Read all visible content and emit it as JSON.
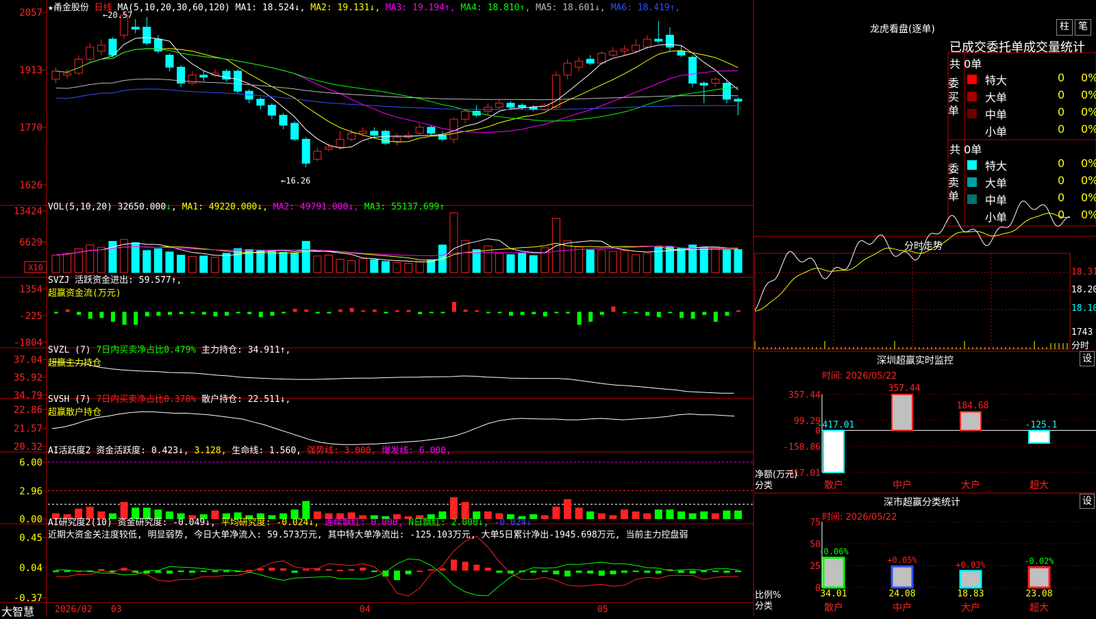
{
  "colors": {
    "up": "#ff2222",
    "down": "#00ffff",
    "grid": "#c00000",
    "text": "#ffffff",
    "yellow": "#ffff00",
    "magenta": "#ff00ff",
    "green": "#00ff00",
    "cyan": "#00ffff",
    "white": "#ffffff",
    "blue": "#3050ff",
    "gray": "#bbbbbb",
    "red": "#ff2222"
  },
  "stock": {
    "name": "★甬金股份",
    "period": "日线",
    "ma_label": "MA(5,10,20,30,60,120)",
    "ma": [
      {
        "name": "MA1:",
        "value": "18.524",
        "arrow": "↓",
        "color": "white"
      },
      {
        "name": "MA2:",
        "value": "19.131",
        "arrow": "↓",
        "color": "yellow"
      },
      {
        "name": "MA3:",
        "value": "19.194",
        "arrow": "↑",
        "color": "magenta"
      },
      {
        "name": "MA4:",
        "value": "18.810",
        "arrow": "↑",
        "color": "green"
      },
      {
        "name": "MA5:",
        "value": "18.601",
        "arrow": "↓",
        "color": "gray"
      },
      {
        "name": "MA6:",
        "value": "18.419",
        "arrow": "↑",
        "color": "blue"
      }
    ],
    "high_label": "←20.57",
    "low_label": "←16.26",
    "price_ticks": [
      "2057",
      "1913",
      "1770",
      "1626"
    ]
  },
  "volume": {
    "label": "VOL(5,10,20)",
    "value": "32650.000",
    "arrow": "↓",
    "ma": [
      {
        "t": "MA1: 49220.000↓,",
        "c": "yellow"
      },
      {
        "t": "MA2: 49791.000↓,",
        "c": "magenta"
      },
      {
        "t": "MA3: 55137.699↑",
        "c": "green"
      }
    ],
    "ticks": [
      "13424",
      "6629"
    ],
    "unit": "X10"
  },
  "svzj": {
    "label": "SVZJ  活跃资金进出: 59.577↑,",
    "sub": "超赢资金流(万元)",
    "ticks": [
      "1354",
      "-225",
      "-1804"
    ]
  },
  "svzl": {
    "label1": "SVZL (7)",
    "label2": "7日内买卖净占比0.479%",
    "label3": "主力持仓: 34.911↑,",
    "sub": "超赢主力持仓",
    "ticks": [
      "37.04",
      "35.92",
      "34.79"
    ]
  },
  "svsh": {
    "label1": "SVSH (7)",
    "label2": "7日内买卖净占比0.378%",
    "label3": "散户持仓: 22.511↓,",
    "sub": "超赢散户持仓",
    "ticks": [
      "22.86",
      "21.57",
      "20.32"
    ]
  },
  "ai1": {
    "label1": "AI活跃度2 资金活跃度: 0.423↓,",
    "label2": "3.128,",
    "label3": "生命线: 1.560,",
    "label4": "强势线: 3.000,",
    "label5": "爆发线: 6.000,",
    "ticks": [
      "6.00",
      "2.96",
      "0.00"
    ]
  },
  "ai2": {
    "label1": "AI研究度2(10) 资金研究度: -0.049↓,",
    "label2": "平均研究度: -0.024↓,",
    "label3": "连续飘红: 0.000,",
    "label4": "N日飘红: 2.000↓,",
    "label5": "-0.024↓",
    "text": "近期大资金关注度较低, 明显弱势, 今日大单净流入: 59.573万元, 其中特大单净流出: -125.103万元, 大单5日累计净出-1945.698万元, 当前主力控盘弱",
    "ticks": [
      "0.45",
      "0.04",
      "-0.37"
    ]
  },
  "bottom": {
    "brand": "大智慧",
    "year": "2026/02",
    "m1": "03",
    "m2": "04",
    "m3": "05"
  },
  "dragon": {
    "title": "龙虎看盘(逐单)",
    "btn1": "柱",
    "btn2": "笔",
    "subtitle": "已成交委托单成交量统计",
    "buy": {
      "total": "共 0单",
      "side": "委买单",
      "rows": [
        {
          "name": "特大",
          "v": "0",
          "p": "0%",
          "c": "#ff0000"
        },
        {
          "name": "大单",
          "v": "0",
          "p": "0%",
          "c": "#a00000"
        },
        {
          "name": "中单",
          "v": "0",
          "p": "0%",
          "c": "#700000"
        },
        {
          "name": "小单",
          "v": "0",
          "p": "0%",
          "c": "#000000"
        }
      ]
    },
    "sell": {
      "total": "共 0单",
      "side": "委卖单",
      "rows": [
        {
          "name": "特大",
          "v": "0",
          "p": "0%",
          "c": "#00ffff"
        },
        {
          "name": "大单",
          "v": "0",
          "p": "0%",
          "c": "#00a0a0"
        },
        {
          "name": "中单",
          "v": "0",
          "p": "0%",
          "c": "#007070"
        },
        {
          "name": "小单",
          "v": "0",
          "p": "0%",
          "c": "#000000"
        }
      ]
    }
  },
  "intraday": {
    "title": "分时走势",
    "ticks": [
      "18.31",
      "18.20",
      "18.10"
    ],
    "vol_tick": "1743",
    "vol_label": "分时"
  },
  "monitor": {
    "title": "深圳超赢实时监控",
    "btn": "设",
    "date": "时间: 2026/05/22",
    "ticks": [
      "357.44",
      "99.29",
      "0",
      "-158.86",
      "-417.01"
    ],
    "ylabel": "净额(万元)",
    "xlabel": "分类",
    "bars": [
      {
        "name": "散户",
        "value": -417.01,
        "label": "-417.01"
      },
      {
        "name": "中户",
        "value": 357.44,
        "label": "357.44"
      },
      {
        "name": "大户",
        "value": 184.68,
        "label": "184.68"
      },
      {
        "name": "超大",
        "value": -125.1,
        "label": "-125.1"
      }
    ]
  },
  "classify": {
    "title": "深市超赢分类统计",
    "btn": "设",
    "date": "时间: 2026/05/22",
    "ticks": [
      "75",
      "50",
      "25",
      "0"
    ],
    "ylabel": "比例%",
    "xlabel": "分类",
    "bars": [
      {
        "name": "散户",
        "value": 34.01,
        "change": "-0.06%",
        "color": "#00ff00"
      },
      {
        "name": "中户",
        "value": 24.08,
        "change": "+0.05%",
        "color": "#3050ff"
      },
      {
        "name": "大户",
        "value": 18.83,
        "change": "+0.03%",
        "color": "#00ffff"
      },
      {
        "name": "超大",
        "value": 23.08,
        "change": "-0.02%",
        "color": "#ff2222"
      }
    ]
  },
  "chart_data": {
    "type": "candlestick",
    "price": {
      "ylim": [
        1626,
        2057
      ],
      "candles": [
        [
          1890,
          1910,
          1880,
          1920
        ],
        [
          1900,
          1905,
          1890,
          1915
        ],
        [
          1905,
          1940,
          1900,
          1950
        ],
        [
          1940,
          1970,
          1930,
          1980
        ],
        [
          1960,
          1975,
          1950,
          1990
        ],
        [
          1990,
          1950,
          1945,
          1995
        ],
        [
          2000,
          2050,
          1990,
          2057
        ],
        [
          2020,
          2015,
          2005,
          2040
        ],
        [
          2020,
          1980,
          1975,
          2045
        ],
        [
          1990,
          1960,
          1955,
          2000
        ],
        [
          1950,
          1920,
          1910,
          1955
        ],
        [
          1920,
          1880,
          1870,
          1925
        ],
        [
          1880,
          1900,
          1875,
          1910
        ],
        [
          1900,
          1895,
          1885,
          1910
        ],
        [
          1900,
          1905,
          1895,
          1915
        ],
        [
          1910,
          1890,
          1885,
          1915
        ],
        [
          1910,
          1860,
          1855,
          1915
        ],
        [
          1860,
          1840,
          1830,
          1865
        ],
        [
          1840,
          1825,
          1815,
          1845
        ],
        [
          1825,
          1800,
          1790,
          1830
        ],
        [
          1800,
          1775,
          1765,
          1805
        ],
        [
          1780,
          1740,
          1735,
          1785
        ],
        [
          1740,
          1680,
          1670,
          1745
        ],
        [
          1690,
          1710,
          1685,
          1720
        ],
        [
          1715,
          1720,
          1710,
          1730
        ],
        [
          1720,
          1740,
          1715,
          1760
        ],
        [
          1740,
          1755,
          1735,
          1765
        ],
        [
          1755,
          1760,
          1745,
          1770
        ],
        [
          1760,
          1750,
          1745,
          1770
        ],
        [
          1760,
          1730,
          1725,
          1765
        ],
        [
          1735,
          1745,
          1725,
          1755
        ],
        [
          1745,
          1750,
          1740,
          1760
        ],
        [
          1755,
          1770,
          1750,
          1780
        ],
        [
          1770,
          1755,
          1750,
          1775
        ],
        [
          1750,
          1740,
          1735,
          1760
        ],
        [
          1740,
          1790,
          1730,
          1795
        ],
        [
          1790,
          1810,
          1780,
          1815
        ],
        [
          1810,
          1800,
          1795,
          1825
        ],
        [
          1810,
          1820,
          1800,
          1830
        ],
        [
          1820,
          1830,
          1815,
          1840
        ],
        [
          1830,
          1820,
          1815,
          1835
        ],
        [
          1825,
          1820,
          1815,
          1830
        ],
        [
          1820,
          1815,
          1810,
          1825
        ],
        [
          1815,
          1825,
          1810,
          1830
        ],
        [
          1820,
          1900,
          1815,
          1910
        ],
        [
          1900,
          1930,
          1890,
          1940
        ],
        [
          1920,
          1935,
          1910,
          1945
        ],
        [
          1940,
          1930,
          1925,
          1950
        ],
        [
          1930,
          1955,
          1925,
          1960
        ],
        [
          1950,
          1960,
          1945,
          1970
        ],
        [
          1960,
          1965,
          1950,
          1975
        ],
        [
          1960,
          1975,
          1955,
          1990
        ],
        [
          1970,
          1990,
          1965,
          2000
        ],
        [
          1990,
          1985,
          1980,
          2035
        ],
        [
          2000,
          1970,
          1960,
          2020
        ],
        [
          1960,
          1950,
          1945,
          1975
        ],
        [
          1945,
          1880,
          1870,
          1950
        ],
        [
          1880,
          1875,
          1830,
          1885
        ],
        [
          1880,
          1890,
          1870,
          1895
        ],
        [
          1880,
          1840,
          1830,
          1885
        ],
        [
          1840,
          1835,
          1800,
          1845
        ]
      ]
    },
    "volume": {
      "ylim": [
        0,
        13424
      ],
      "values": [
        3800,
        4200,
        5200,
        6000,
        5500,
        6800,
        7200,
        6500,
        4800,
        5200,
        4500,
        3800,
        3500,
        3600,
        3300,
        4200,
        5200,
        5000,
        4800,
        4600,
        4400,
        4200,
        6800,
        3600,
        3800,
        2900,
        2600,
        3000,
        2800,
        2400,
        2200,
        2000,
        2300,
        2800,
        6000,
        13000,
        7000,
        5000,
        5800,
        4200,
        3900,
        4300,
        3700,
        5400,
        11800,
        6900,
        5600,
        4900,
        4900,
        4600,
        4800,
        3900,
        4200,
        5500,
        5600,
        5300,
        6000,
        5500,
        5400,
        4900,
        5000,
        3700,
        3200
      ]
    },
    "money_flow": {
      "ylim": [
        -1804,
        1354
      ],
      "values": [
        -200,
        320,
        -400,
        -900,
        -800,
        -1300,
        -1700,
        -1700,
        -600,
        -500,
        -400,
        -300,
        -200,
        -350,
        -600,
        -500,
        -200,
        -300,
        -700,
        -500,
        -200,
        400,
        300,
        -200,
        -200,
        300,
        500,
        200,
        300,
        -200,
        200,
        250,
        -300,
        -100,
        -100,
        1300,
        300,
        200,
        -100,
        -100,
        -500,
        -400,
        -300,
        -600,
        -100,
        -200,
        -1700,
        -1300,
        -400,
        700,
        -100,
        -100,
        -500,
        -700,
        -100,
        -800,
        -900,
        -400,
        -1300,
        -500,
        200,
        -200,
        -200
      ]
    },
    "main_hold": {
      "ylim": [
        34.79,
        37.04
      ],
      "values": [
        36.9,
        36.88,
        36.82,
        36.72,
        36.55,
        36.45,
        36.38,
        36.33,
        36.3,
        36.27,
        36.22,
        36.2,
        36.18,
        36.12,
        36.05,
        36,
        35.92,
        35.88,
        35.85,
        35.82,
        35.8,
        35.78,
        35.78,
        35.8,
        35.82,
        35.85,
        35.86,
        35.86,
        35.88,
        35.9,
        35.92,
        35.92,
        35.94,
        35.95,
        35.96,
        36.0,
        35.98,
        35.93,
        35.9,
        35.86,
        35.85,
        35.84,
        35.84,
        35.84,
        35.8,
        35.7,
        35.6,
        35.5,
        35.42,
        35.38,
        35.32,
        35.25,
        35.18,
        35.12,
        35.02,
        34.98,
        34.94,
        34.91,
        34.91
      ]
    },
    "retail_hold": {
      "ylim": [
        20.32,
        22.86
      ],
      "values": [
        21.55,
        21.65,
        21.85,
        22.1,
        22.3,
        22.4,
        22.55,
        22.65,
        22.7,
        22.7,
        22.65,
        22.6,
        22.6,
        22.55,
        22.5,
        22.4,
        22.3,
        22.2,
        22.0,
        21.8,
        21.55,
        21.3,
        21.05,
        20.8,
        20.6,
        20.5,
        20.45,
        20.45,
        20.47,
        20.5,
        20.55,
        20.6,
        20.65,
        20.7,
        20.8,
        20.9,
        21.05,
        21.3,
        21.6,
        21.9,
        22.1,
        22.2,
        22.25,
        22.22,
        22.2,
        22.2,
        22.15,
        22.15,
        22.2,
        22.25,
        22.2,
        22.15,
        22.2,
        22.25,
        22.3,
        22.38,
        22.5,
        22.55,
        22.5,
        22.5,
        22.45,
        22.4
      ]
    },
    "activity": {
      "ylim": [
        0,
        6.0
      ],
      "values": [
        0.6,
        0.5,
        1.1,
        1.3,
        0.8,
        0.6,
        1.8,
        1.2,
        1.2,
        1.0,
        0.8,
        0.6,
        0.4,
        0.5,
        0.9,
        0.6,
        0.7,
        0.4,
        0.6,
        0.4,
        0.6,
        1.0,
        1.9,
        0.8,
        0.6,
        0.6,
        0.7,
        0.4,
        0.4,
        0.3,
        0.5,
        0.3,
        0.4,
        0.5,
        0.8,
        2.3,
        1.8,
        0.8,
        0.8,
        0.6,
        0.5,
        0.3,
        0.5,
        0.4,
        1.3,
        2.1,
        1.2,
        0.8,
        0.6,
        0.4,
        1.0,
        0.8,
        0.6,
        1.0,
        1.0,
        0.8,
        0.6,
        0.8,
        0.6,
        0.9,
        0.9,
        0.5,
        0.3
      ]
    },
    "research": {
      "ylim": [
        -0.37,
        0.45
      ],
      "values": [
        -0.02,
        -0.02,
        0.0,
        -0.02,
        0.02,
        -0.02,
        0.03,
        -0.03,
        -0.04,
        -0.03,
        -0.04,
        -0.02,
        -0.03,
        -0.01,
        -0.02,
        -0.02,
        -0.01,
        0.01,
        0.03,
        0.04,
        0.03,
        -0.03,
        0.02,
        0.03,
        0.02,
        0.01,
        0.02,
        0.04,
        -0.02,
        -0.08,
        -0.13,
        -0.05,
        0.0,
        0.02,
        0.03,
        0.15,
        0.12,
        0.08,
        0.04,
        -0.03,
        -0.04,
        -0.02,
        -0.03,
        -0.02,
        -0.05,
        -0.08,
        -0.03,
        -0.04,
        -0.07,
        -0.05,
        -0.03,
        -0.01,
        -0.03,
        -0.04,
        0.02,
        -0.03,
        -0.04,
        -0.02,
        -0.01,
        -0.03,
        -0.02,
        -0.02,
        -0.02
      ]
    },
    "intraday": {
      "ylim": [
        18.05,
        18.35
      ]
    }
  }
}
